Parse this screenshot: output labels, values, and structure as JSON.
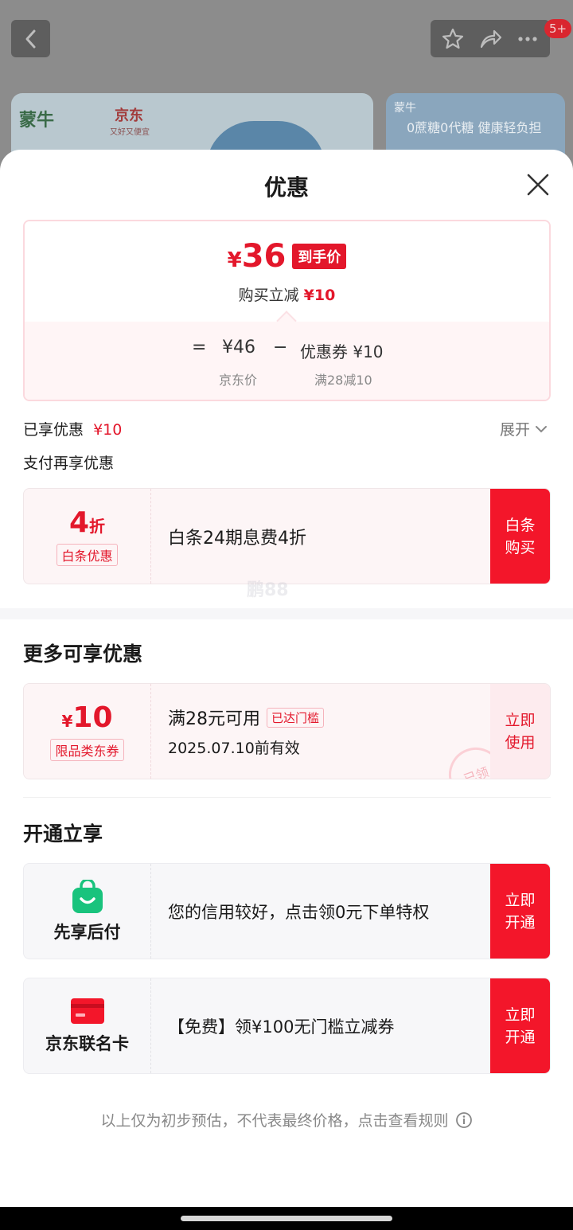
{
  "background": {
    "notification_count": "5+",
    "banner_left": {
      "brand1": "蒙牛",
      "brand2": "京东",
      "slogan": "又好又便宜"
    },
    "banner_right": {
      "brand": "蒙牛",
      "text": "0蔗糖0代糖 健康轻负担"
    }
  },
  "sheet": {
    "title": "优惠",
    "price": {
      "currency": "¥",
      "amount": "36",
      "tag": "到手价",
      "reduce_label": "购买立减",
      "reduce_value": "¥10",
      "eq": "=",
      "jd_price": "¥46",
      "minus": "−",
      "coupon": "优惠券 ¥10",
      "jd_price_label": "京东价",
      "coupon_label": "满28减10"
    },
    "enjoyed_label": "已享优惠",
    "enjoyed_value": "¥10",
    "expand_label": "展开",
    "pay_more_label": "支付再享优惠",
    "baitiao": {
      "discount_num": "4",
      "discount_unit": "折",
      "tag": "白条优惠",
      "desc": "白条24期息费4折",
      "button": "白条\n购买"
    },
    "watermark": "鹏88",
    "more_title": "更多可享优惠",
    "coupon": {
      "currency": "¥",
      "amount": "10",
      "tag": "限品类东券",
      "condition": "满28元可用",
      "status": "已达门槛",
      "expiry": "2025.07.10前有效",
      "stamp": "已领",
      "button": "立即\n使用"
    },
    "open_title": "开通立享",
    "xianxiang": {
      "name": "先享后付",
      "desc": "您的信用较好，点击领0元下单特权",
      "button": "立即\n开通"
    },
    "cobrand": {
      "name": "京东联名卡",
      "desc": "【免费】领¥100无门槛立减券",
      "button": "立即\n开通"
    },
    "footer": "以上仅为初步预估，不代表最终价格，点击查看规则"
  }
}
